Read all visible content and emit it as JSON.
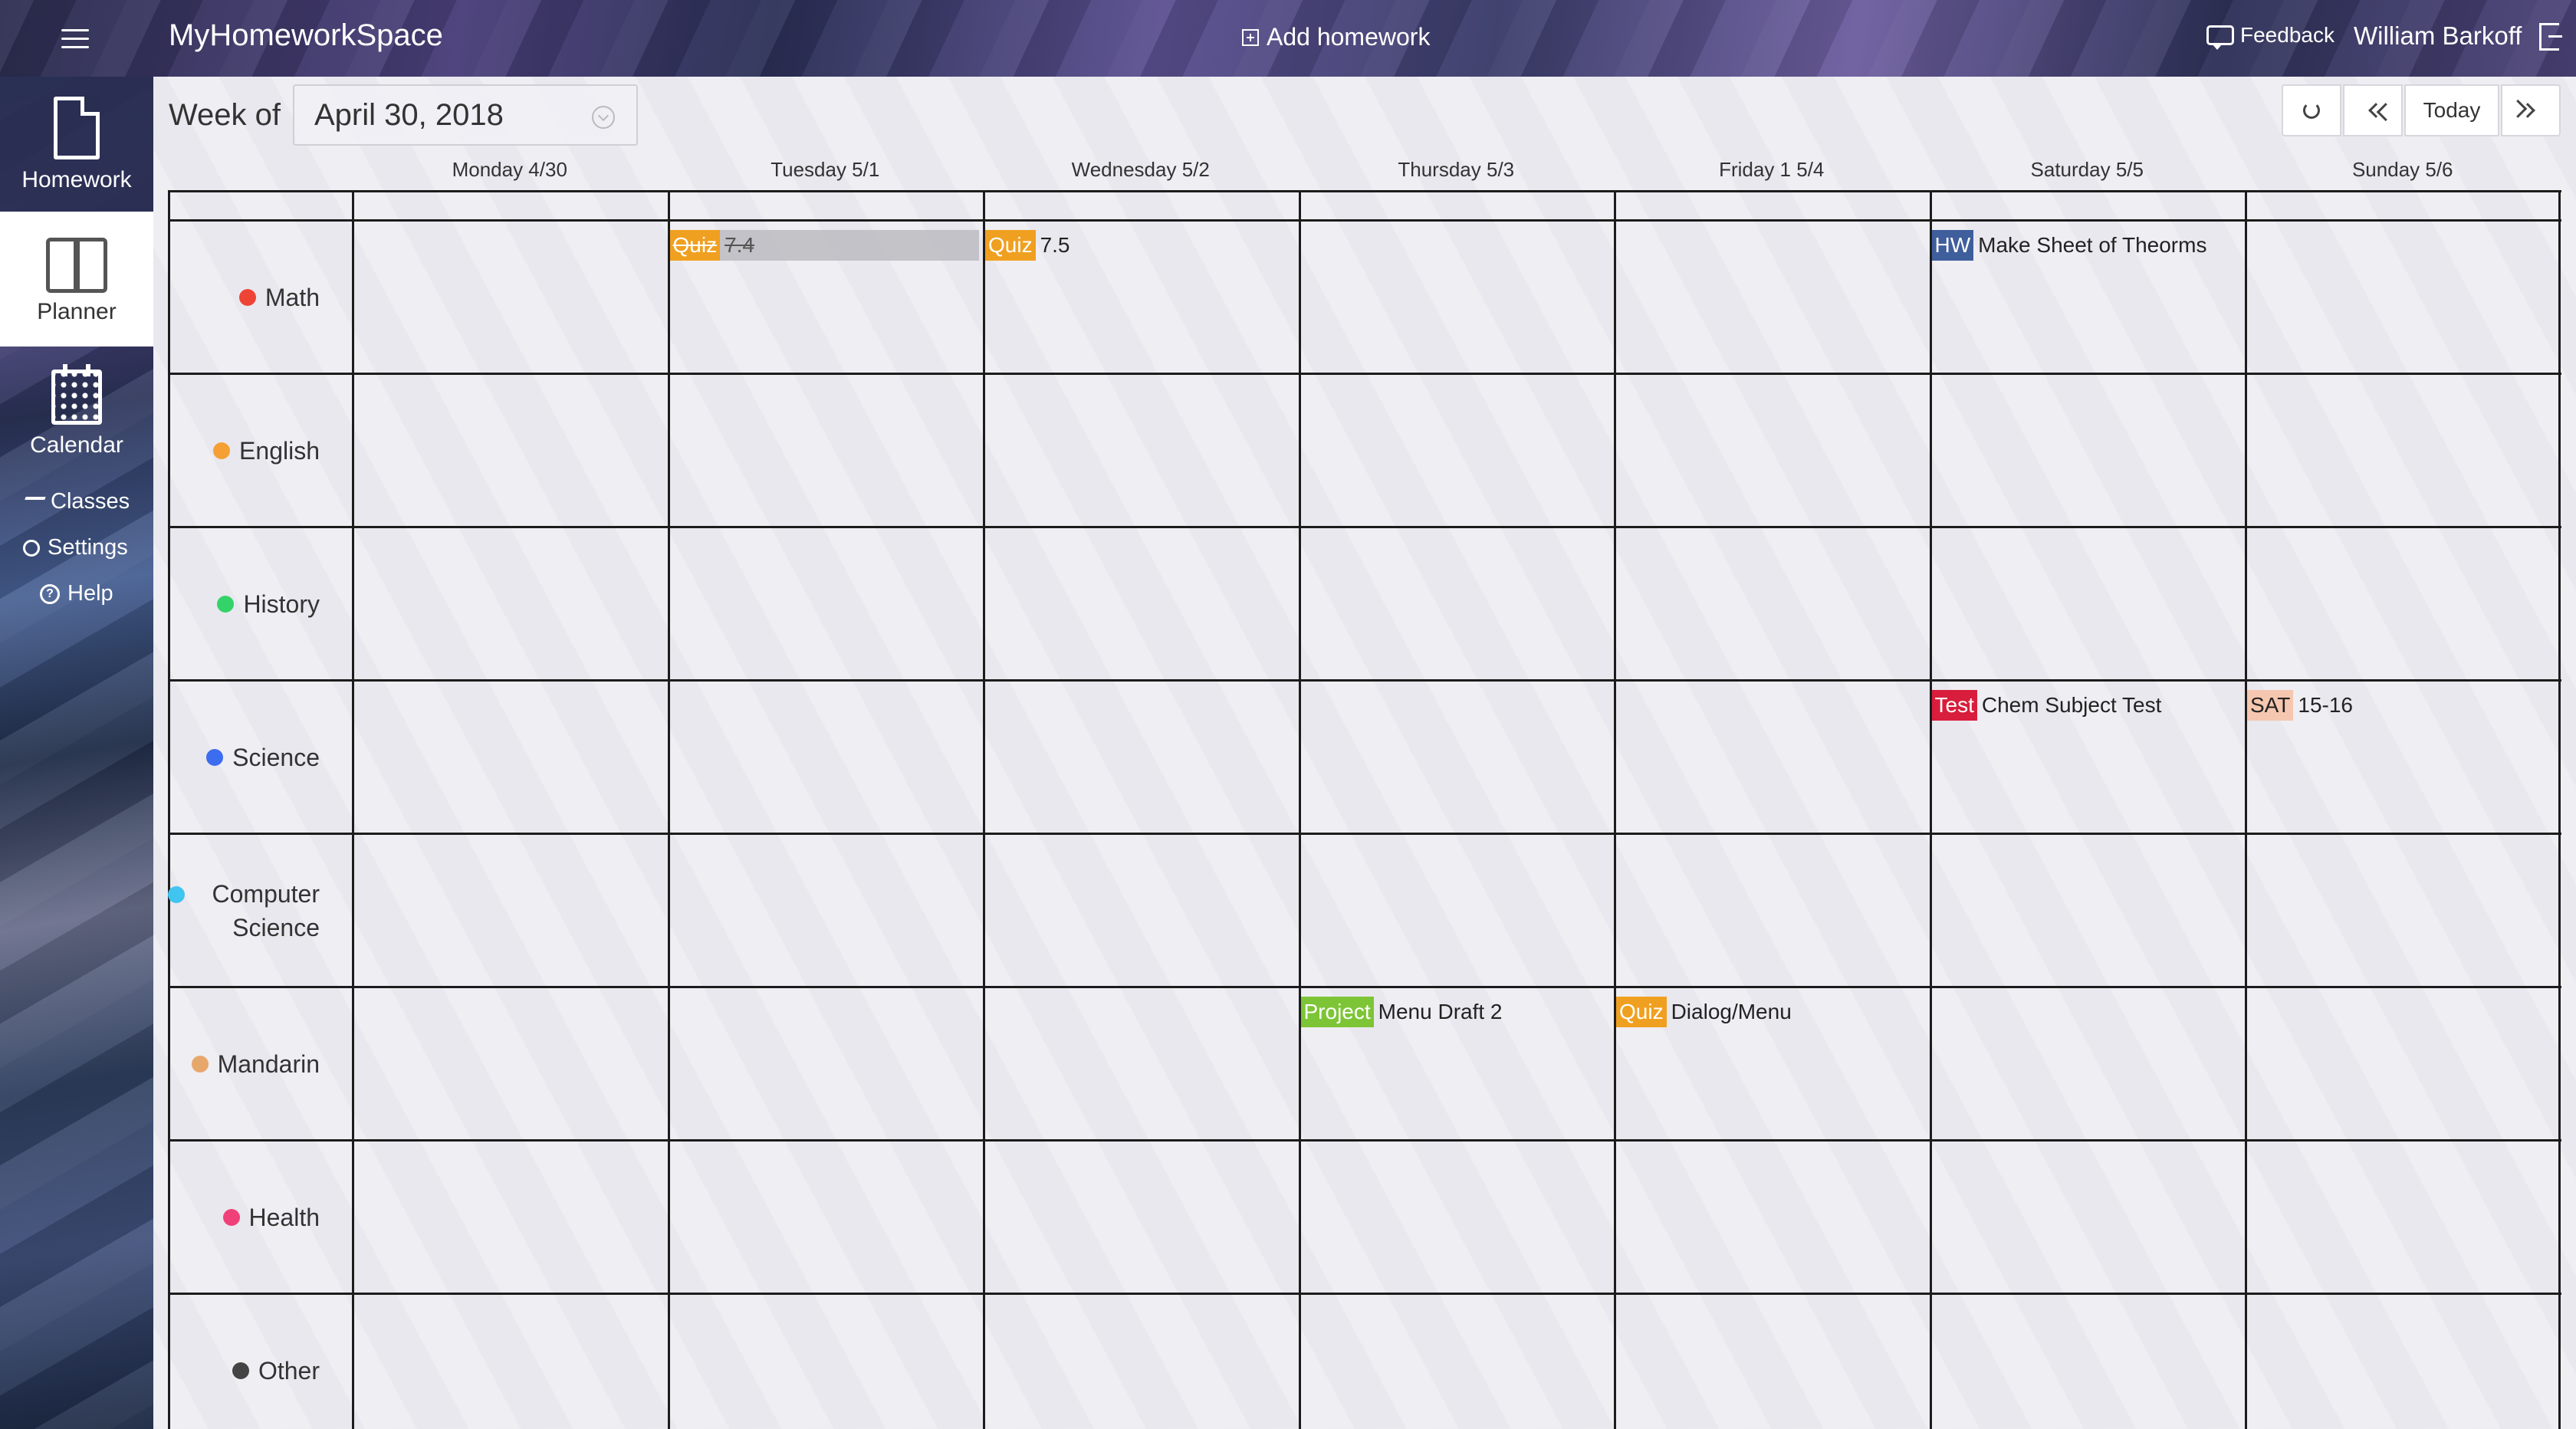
{
  "app": {
    "title": "MyHomeworkSpace",
    "add_homework": "Add homework",
    "feedback": "Feedback",
    "user": "William Barkoff"
  },
  "sidebar": {
    "homework": "Homework",
    "planner": "Planner",
    "calendar": "Calendar",
    "classes": "Classes",
    "settings": "Settings",
    "help": "Help"
  },
  "week": {
    "label": "Week of",
    "value": "April 30, 2018"
  },
  "controls": {
    "today": "Today"
  },
  "days": [
    "Monday 4/30",
    "Tuesday 5/1",
    "Wednesday 5/2",
    "Thursday 5/3",
    "Friday 1 5/4",
    "Saturday 5/5",
    "Sunday 5/6"
  ],
  "classes": [
    {
      "name": "Math",
      "color": "#ee4436"
    },
    {
      "name": "English",
      "color": "#f5a035"
    },
    {
      "name": "History",
      "color": "#34d36a"
    },
    {
      "name": "Science",
      "color": "#3c6cf0"
    },
    {
      "name": "Computer Science",
      "color": "#40c4f0"
    },
    {
      "name": "Mandarin",
      "color": "#e8a76a"
    },
    {
      "name": "Health",
      "color": "#f0407a"
    },
    {
      "name": "Other",
      "color": "#444444"
    }
  ],
  "events": [
    {
      "class": 0,
      "day": 1,
      "tag": "Quiz",
      "tag_color": "#f0a020",
      "text": "7.4",
      "done": true
    },
    {
      "class": 0,
      "day": 2,
      "tag": "Quiz",
      "tag_color": "#f0a020",
      "text": "7.5",
      "done": false
    },
    {
      "class": 0,
      "day": 5,
      "tag": "HW",
      "tag_color": "#3f5e9c",
      "text": "Make Sheet of Theorms",
      "done": false
    },
    {
      "class": 3,
      "day": 5,
      "tag": "Test",
      "tag_color": "#d81e3c",
      "text": "Chem Subject Test",
      "done": false
    },
    {
      "class": 3,
      "day": 6,
      "tag": "SAT",
      "tag_color": "#f6c7b0",
      "tag_text_color": "#222",
      "text": "15-16",
      "done": false
    },
    {
      "class": 5,
      "day": 3,
      "tag": "Project",
      "tag_color": "#7dc536",
      "text": "Menu Draft 2",
      "done": false
    },
    {
      "class": 5,
      "day": 4,
      "tag": "Quiz",
      "tag_color": "#f0a020",
      "text": "Dialog/Menu",
      "done": false
    }
  ]
}
